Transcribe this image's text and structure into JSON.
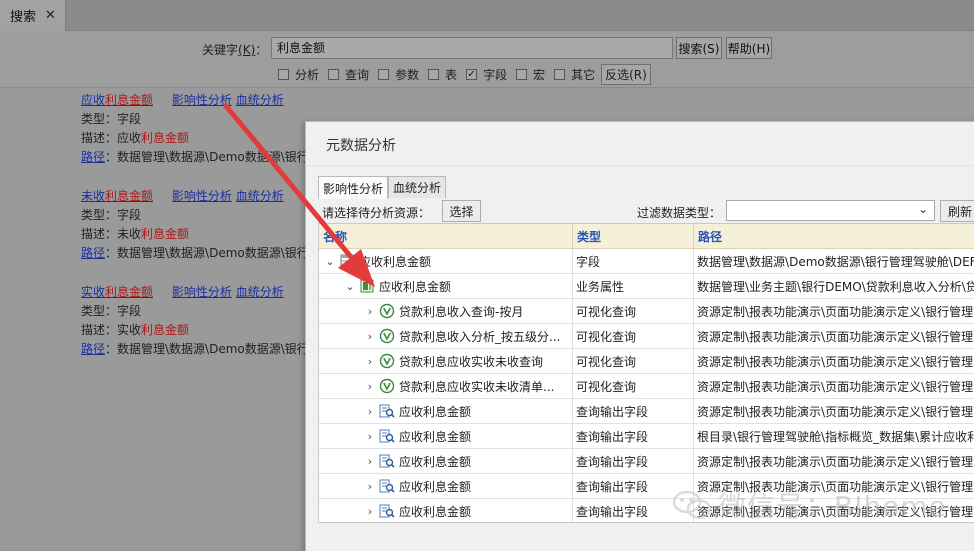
{
  "tab": {
    "title": "搜索",
    "close": "✕"
  },
  "search": {
    "keyword_label": "关键字",
    "keyword_hotkey": "(K)",
    "keyword_colon": "：",
    "keyword_value": "利息金额",
    "search_button": "搜索(S)",
    "help_button": "帮助(H)",
    "filters": [
      {
        "label": "分析",
        "checked": false
      },
      {
        "label": "查询",
        "checked": false
      },
      {
        "label": "参数",
        "checked": false
      },
      {
        "label": "表",
        "checked": false
      },
      {
        "label": "字段",
        "checked": true
      },
      {
        "label": "宏",
        "checked": false
      },
      {
        "label": "其它",
        "checked": false
      }
    ],
    "invert_button": "反选(R)"
  },
  "results": [
    {
      "prefix": "应收",
      "highlight": "利息金额",
      "impact_link": "影响性分析",
      "lineage_link": "血统分析",
      "type_line": "类型：字段",
      "desc_prefix": "描述：应收",
      "desc_highlight": "利息金额",
      "path_label": "路径",
      "path_value": "：数据管理\\数据源\\Demo数据源\\银行"
    },
    {
      "prefix": "未收",
      "highlight": "利息金额",
      "impact_link": "影响性分析",
      "lineage_link": "血统分析",
      "type_line": "类型：字段",
      "desc_prefix": "描述：未收",
      "desc_highlight": "利息金额",
      "path_label": "路径",
      "path_value": "：数据管理\\数据源\\Demo数据源\\银行"
    },
    {
      "prefix": "实收",
      "highlight": "利息金额",
      "impact_link": "影响性分析",
      "lineage_link": "血统分析",
      "type_line": "类型：字段",
      "desc_prefix": "描述：实收",
      "desc_highlight": "利息金额",
      "path_label": "路径",
      "path_value": "：数据管理\\数据源\\Demo数据源\\银行"
    }
  ],
  "dialog": {
    "title": "元数据分析",
    "tabs": [
      "影响性分析",
      "血统分析"
    ],
    "choose_label": "请选择待分析资源：",
    "choose_button": "选择",
    "filter_label": "过滤数据类型：",
    "filter_value": "",
    "refresh_button": "刷新",
    "columns": [
      "名称",
      "类型",
      "路径"
    ],
    "rows": [
      {
        "twisty": "⌄",
        "icon": "field-icon",
        "name": "应收利息金额",
        "type": "字段",
        "path": "数据管理\\数据源\\Demo数据源\\银行管理驾驶舱\\DEF"
      },
      {
        "twisty": "⌄",
        "icon": "business-attribute-icon",
        "name": "应收利息金额",
        "type": "业务属性",
        "path": "数据管理\\业务主题\\银行DEMO\\贷款利息收入分析\\贷"
      },
      {
        "twisty": "›",
        "icon": "visual-query-icon",
        "name": "贷款利息收入查询-按月",
        "type": "可视化查询",
        "path": "资源定制\\报表功能演示\\页面功能演示定义\\银行管理驾"
      },
      {
        "twisty": "›",
        "icon": "visual-query-icon",
        "name": "贷款利息收入分析_按五级分...",
        "type": "可视化查询",
        "path": "资源定制\\报表功能演示\\页面功能演示定义\\银行管理驾"
      },
      {
        "twisty": "›",
        "icon": "visual-query-icon",
        "name": "贷款利息应收实收未收查询",
        "type": "可视化查询",
        "path": "资源定制\\报表功能演示\\页面功能演示定义\\银行管理驾"
      },
      {
        "twisty": "›",
        "icon": "visual-query-icon",
        "name": "贷款利息应收实收未收清单...",
        "type": "可视化查询",
        "path": "资源定制\\报表功能演示\\页面功能演示定义\\银行管理驾"
      },
      {
        "twisty": "›",
        "icon": "query-output-field-icon",
        "name": "应收利息金额",
        "type": "查询输出字段",
        "path": "资源定制\\报表功能演示\\页面功能演示定义\\银行管理驾"
      },
      {
        "twisty": "›",
        "icon": "query-output-field-icon",
        "name": "应收利息金额",
        "type": "查询输出字段",
        "path": "根目录\\银行管理驾驶舱\\指标概览_数据集\\累计应收利"
      },
      {
        "twisty": "›",
        "icon": "query-output-field-icon",
        "name": "应收利息金额",
        "type": "查询输出字段",
        "path": "资源定制\\报表功能演示\\页面功能演示定义\\银行管理驾"
      },
      {
        "twisty": "›",
        "icon": "query-output-field-icon",
        "name": "应收利息金额",
        "type": "查询输出字段",
        "path": "资源定制\\报表功能演示\\页面功能演示定义\\银行管理驾"
      },
      {
        "twisty": "›",
        "icon": "query-output-field-icon",
        "name": "应收利息金额",
        "type": "查询输出字段",
        "path": "资源定制\\报表功能演示\\页面功能演示定义\\银行管理驾"
      }
    ]
  },
  "watermark": {
    "text": "微信号：BIhome"
  },
  "colors": {
    "highlight": "#b01818",
    "link": "#1a2fa0",
    "header_bg": "#f5f0da",
    "header_text": "#2a55b8",
    "arrow": "#e23b3b"
  }
}
